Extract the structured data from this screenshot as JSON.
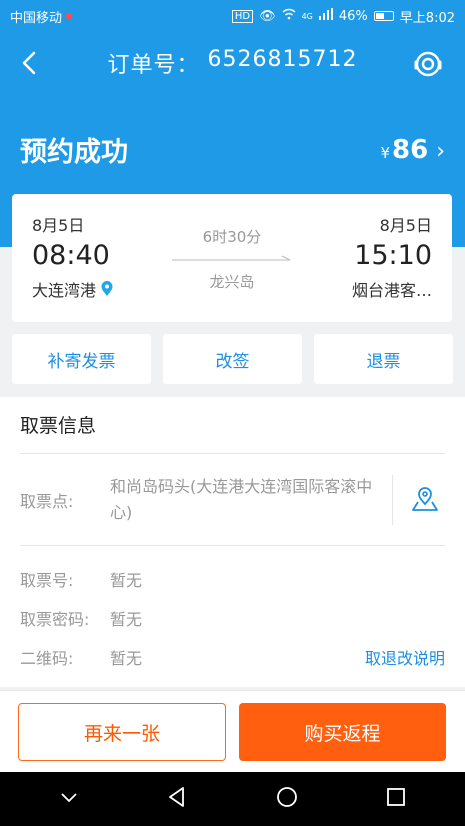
{
  "status_bar": {
    "carrier": "中国移动",
    "hd": "HD",
    "network": "4G",
    "battery": "46%",
    "time": "早上8:02"
  },
  "nav": {
    "order_label": "订单号：",
    "order_number": "6526815712"
  },
  "summary": {
    "status": "预约成功",
    "currency": "¥",
    "amount": "86"
  },
  "trip": {
    "departure": {
      "date": "8月5日",
      "time": "08:40",
      "port": "大连湾港"
    },
    "arrival": {
      "date": "8月5日",
      "time": "15:10",
      "port": "烟台港客…"
    },
    "duration": "6时30分",
    "vessel": "龙兴岛"
  },
  "actions": [
    "补寄发票",
    "改签",
    "退票"
  ],
  "ticket_info": {
    "title": "取票信息",
    "pickup_label": "取票点:",
    "pickup_value": "和尚岛码头(大连港大连湾国际客滚中心)",
    "ticket_no_label": "取票号:",
    "ticket_no_value": "暂无",
    "password_label": "取票密码:",
    "password_value": "暂无",
    "qr_label": "二维码:",
    "qr_value": "暂无",
    "refund_link": "取退改说明"
  },
  "bottom": {
    "again": "再来一张",
    "return_trip": "购买返程"
  },
  "colors": {
    "primary": "#1f9ae6",
    "link": "#1e8fe0",
    "accent": "#ff5f0f"
  },
  "icons": [
    "back-arrow-icon",
    "customer-service-icon",
    "location-pin-icon",
    "map-location-icon",
    "chevron-right-icon",
    "nav-down-icon",
    "nav-back-icon",
    "nav-home-icon",
    "nav-recent-icon"
  ]
}
